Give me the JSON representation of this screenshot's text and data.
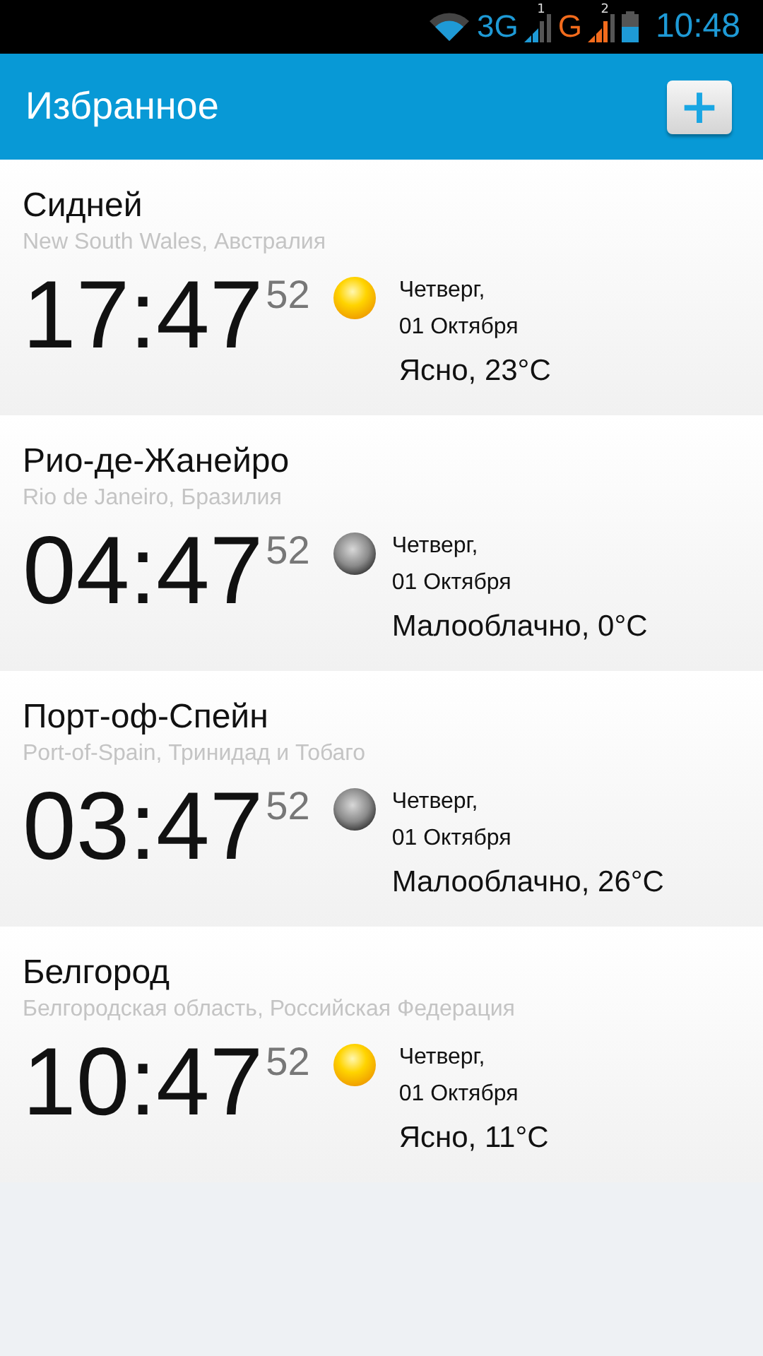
{
  "status_bar": {
    "network_1": "3G",
    "sim_1": "1",
    "network_2": "G",
    "sim_2": "2",
    "time": "10:48"
  },
  "header": {
    "title": "Избранное",
    "add_button": "+"
  },
  "cities": [
    {
      "name": "Сидней",
      "region": "New South Wales, Австралия",
      "time": "17:47",
      "seconds": "52",
      "kind": "sun",
      "day": "Четверг,",
      "date": "01 Октября",
      "weather": "Ясно, 23°C"
    },
    {
      "name": "Рио-де-Жанейро",
      "region": "Rio de Janeiro, Бразилия",
      "time": "04:47",
      "seconds": "52",
      "kind": "moon",
      "day": "Четверг,",
      "date": "01 Октября",
      "weather": "Малооблачно, 0°C"
    },
    {
      "name": "Порт-оф-Спейн",
      "region": "Port-of-Spain, Тринидад и Тобаго",
      "time": "03:47",
      "seconds": "52",
      "kind": "moon",
      "day": "Четверг,",
      "date": "01 Октября",
      "weather": "Малооблачно, 26°C"
    },
    {
      "name": "Белгород",
      "region": "Белгородская область, Российская Федерация",
      "time": "10:47",
      "seconds": "52",
      "kind": "sun",
      "day": "Четверг,",
      "date": "01 Октября",
      "weather": "Ясно, 11°C"
    }
  ]
}
